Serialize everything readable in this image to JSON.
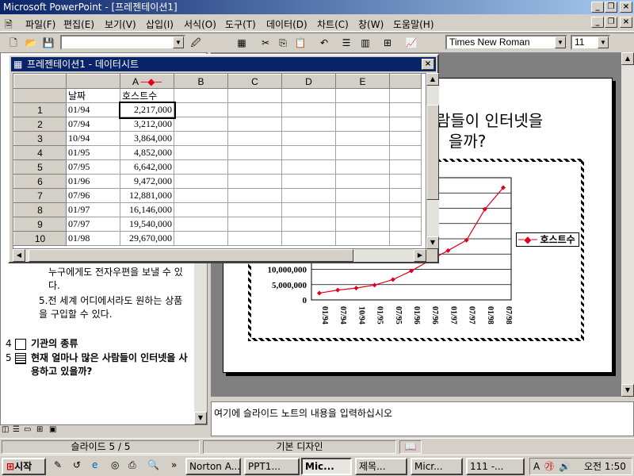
{
  "window": {
    "title": "Microsoft PowerPoint - [프레젠테이션1]",
    "min": "_",
    "max": "❐",
    "close": "×"
  },
  "menu": [
    "파일(F)",
    "편집(E)",
    "보기(V)",
    "삽입(I)",
    "서식(O)",
    "도구(T)",
    "데이터(D)",
    "차트(C)",
    "창(W)",
    "도움말(H)"
  ],
  "toolbar": {
    "font": "Times New Roman",
    "size": "11"
  },
  "datasheet": {
    "title": "프레젠테이션1 - 데이터시트",
    "columns": [
      "A",
      "B",
      "C",
      "D",
      "E"
    ],
    "header_row": [
      "날짜",
      "호스트수"
    ],
    "rows": [
      {
        "n": "1",
        "date": "01/94",
        "hosts": "2,217,000"
      },
      {
        "n": "2",
        "date": "07/94",
        "hosts": "3,212,000"
      },
      {
        "n": "3",
        "date": "10/94",
        "hosts": "3,864,000"
      },
      {
        "n": "4",
        "date": "01/95",
        "hosts": "4,852,000"
      },
      {
        "n": "5",
        "date": "07/95",
        "hosts": "6,642,000"
      },
      {
        "n": "6",
        "date": "01/96",
        "hosts": "9,472,000"
      },
      {
        "n": "7",
        "date": "07/96",
        "hosts": "12,881,000"
      },
      {
        "n": "8",
        "date": "01/97",
        "hosts": "16,146,000"
      },
      {
        "n": "9",
        "date": "07/97",
        "hosts": "19,540,000"
      },
      {
        "n": "10",
        "date": "01/98",
        "hosts": "29,670,000"
      }
    ]
  },
  "outline": {
    "item4_text": "누구에게도 전자우편을 보낼 수 있다.",
    "item5_text": "5.전 세계 어디에서라도 원하는 상품을 구입할 수 있다.",
    "slide4_num": "4",
    "slide4_title": "기관의 종류",
    "slide5_num": "5",
    "slide5_title": "현재 얼마나 많은 사람들이 인터넷을 사용하고 있을까?"
  },
  "slide": {
    "title_line1": "람들이 인터넷을",
    "title_line2": "을까?"
  },
  "chart_data": {
    "type": "line",
    "x": [
      "01/94",
      "07/94",
      "10/94",
      "01/95",
      "07/95",
      "01/96",
      "07/96",
      "01/97",
      "07/97",
      "01/98",
      "07/98"
    ],
    "series": [
      {
        "name": "호스트수",
        "values": [
          2217000,
          3212000,
          3864000,
          4852000,
          6642000,
          9472000,
          12881000,
          16146000,
          19540000,
          29670000,
          36739000
        ]
      }
    ],
    "ylim": [
      0,
      40000000
    ],
    "yticks_visible": [
      "0",
      "5,000,000",
      "10,000,000"
    ],
    "legend": "right",
    "color": "#e0001a"
  },
  "notes": {
    "placeholder": "여기에 슬라이드 노트의 내용을 입력하십시오"
  },
  "status": {
    "slide": "슬라이드 5 / 5",
    "design": "기본 디자인"
  },
  "taskbar": {
    "start": "시작",
    "tasks": [
      "Norton A...",
      "PPT1...",
      "Mic...",
      "제목...",
      "Micr...",
      "111 -..."
    ],
    "clock": "오전 1:50"
  }
}
